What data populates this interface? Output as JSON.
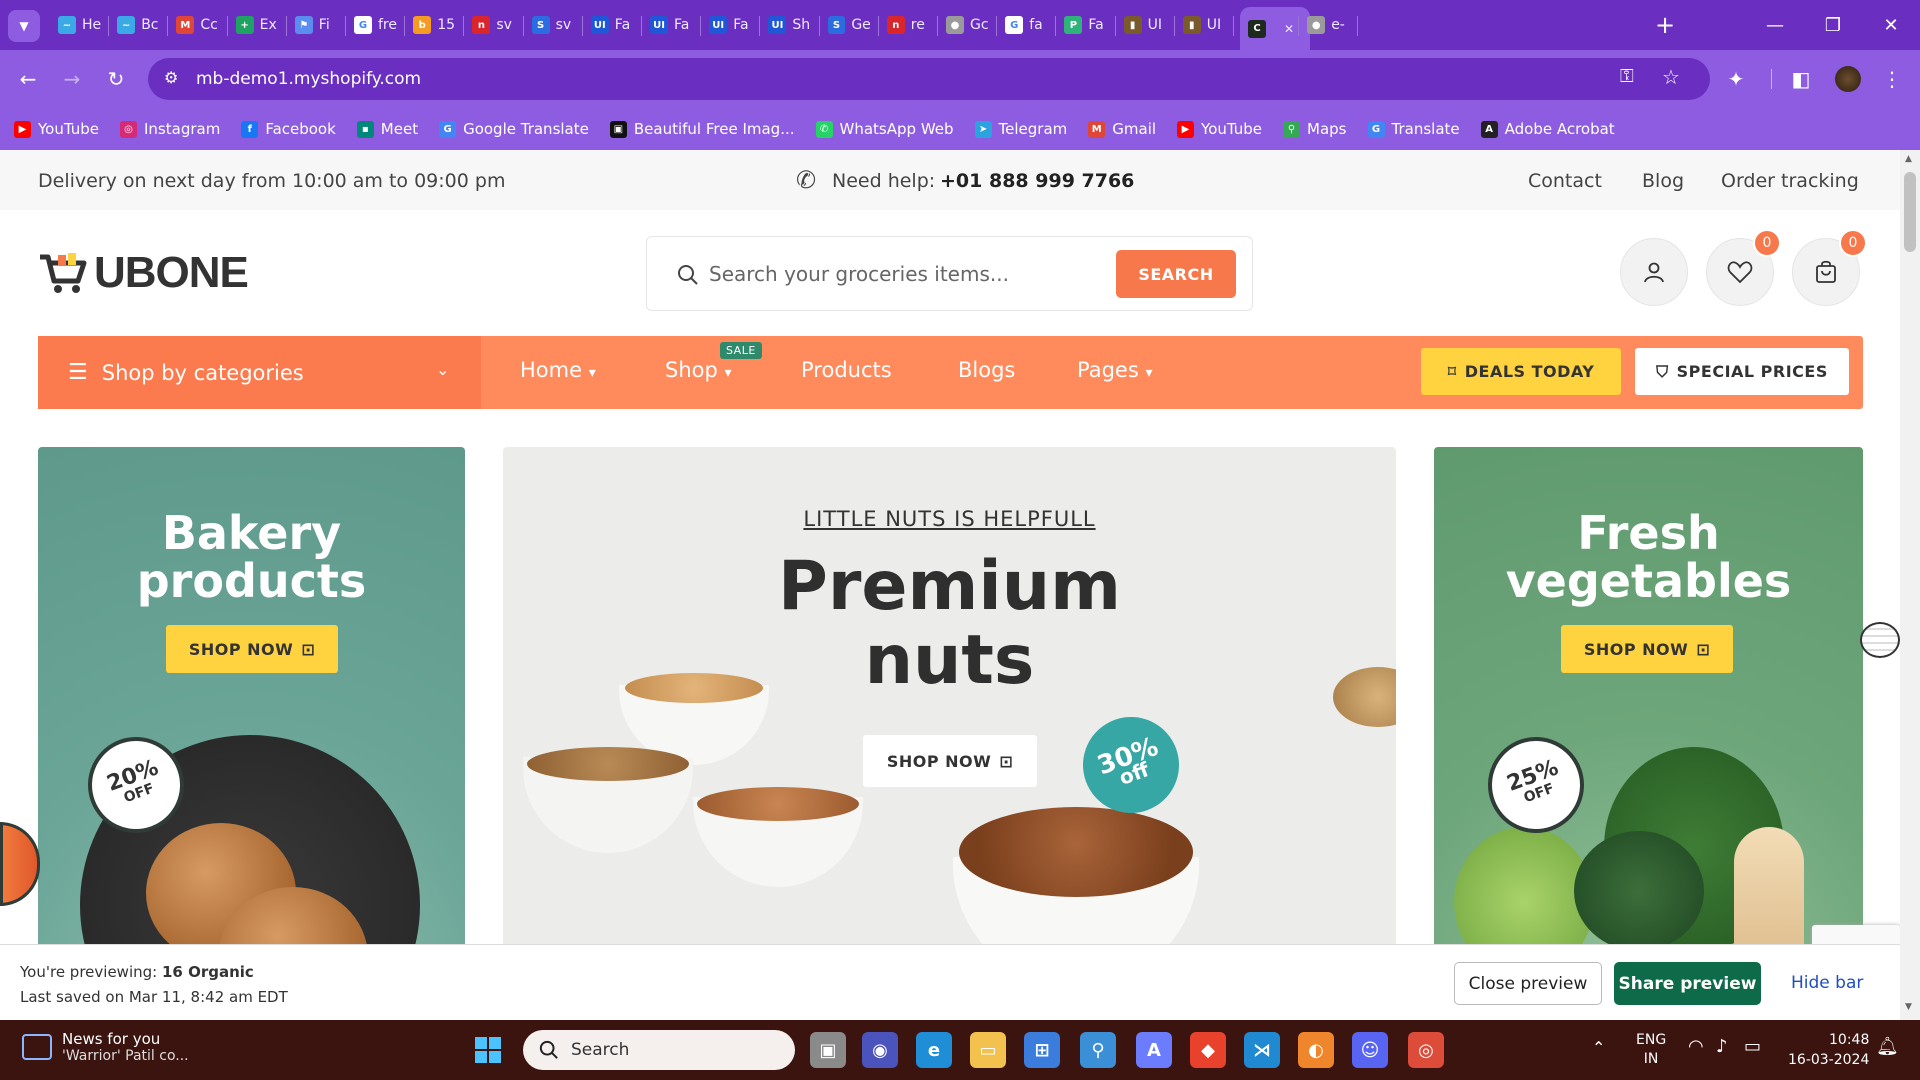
{
  "browser": {
    "tabs": [
      {
        "label": "He",
        "color": "#3aa9e6",
        "glyph": "~"
      },
      {
        "label": "Bc",
        "color": "#3aa9e6",
        "glyph": "~"
      },
      {
        "label": "Cc",
        "color": "#e04638",
        "glyph": "M"
      },
      {
        "label": "Ex",
        "color": "#1ea362",
        "glyph": "+"
      },
      {
        "label": "Fi",
        "color": "#5b8def",
        "glyph": "⚑"
      },
      {
        "label": "fre",
        "color": "#ffffff",
        "glyph": "G"
      },
      {
        "label": "15",
        "color": "#f59a23",
        "glyph": "b"
      },
      {
        "label": "sv",
        "color": "#d9262c",
        "glyph": "n"
      },
      {
        "label": "sv",
        "color": "#2b6de0",
        "glyph": "S"
      },
      {
        "label": "Fa",
        "color": "#1f57d6",
        "glyph": "UI"
      },
      {
        "label": "Fa",
        "color": "#1f57d6",
        "glyph": "UI"
      },
      {
        "label": "Fa",
        "color": "#1f57d6",
        "glyph": "UI"
      },
      {
        "label": "Sh",
        "color": "#1f57d6",
        "glyph": "UI"
      },
      {
        "label": "Ge",
        "color": "#2b6de0",
        "glyph": "S"
      },
      {
        "label": "re",
        "color": "#d9262c",
        "glyph": "n"
      },
      {
        "label": "Gc",
        "color": "#9a9a9a",
        "glyph": "●"
      },
      {
        "label": "fa",
        "color": "#ffffff",
        "glyph": "G"
      },
      {
        "label": "Fa",
        "color": "#2fb37a",
        "glyph": "P"
      },
      {
        "label": "UI",
        "color": "#7a5a2a",
        "glyph": "▮"
      },
      {
        "label": "UI",
        "color": "#7a5a2a",
        "glyph": "▮"
      },
      {
        "label": "",
        "color": "#1d2a1d",
        "glyph": "C",
        "active": true
      },
      {
        "label": "e-",
        "color": "#9a9a9a",
        "glyph": "●"
      }
    ],
    "new_tab": "+",
    "url": "mb-demo1.myshopify.com",
    "bookmarks": [
      {
        "label": "YouTube",
        "color": "#ff0000",
        "glyph": "▶"
      },
      {
        "label": "Instagram",
        "color": "#d62976",
        "glyph": "◎"
      },
      {
        "label": "Facebook",
        "color": "#1877f2",
        "glyph": "f"
      },
      {
        "label": "Meet",
        "color": "#00897b",
        "glyph": "▪"
      },
      {
        "label": "Google Translate",
        "color": "#4285f4",
        "glyph": "G"
      },
      {
        "label": "Beautiful Free Imag...",
        "color": "#111111",
        "glyph": "▣"
      },
      {
        "label": "WhatsApp Web",
        "color": "#25d366",
        "glyph": "✆"
      },
      {
        "label": "Telegram",
        "color": "#2aa3e0",
        "glyph": "➤"
      },
      {
        "label": "Gmail",
        "color": "#e04638",
        "glyph": "M"
      },
      {
        "label": "YouTube",
        "color": "#ff0000",
        "glyph": "▶"
      },
      {
        "label": "Maps",
        "color": "#34a853",
        "glyph": "⚲"
      },
      {
        "label": "Translate",
        "color": "#4285f4",
        "glyph": "G"
      },
      {
        "label": "Adobe Acrobat",
        "color": "#222222",
        "glyph": "A"
      }
    ]
  },
  "store": {
    "topbar": {
      "delivery": "Delivery on next day from 10:00 am to 09:00 pm",
      "help_label": "Need help:",
      "phone": "+01 888 999 7766",
      "links": [
        "Contact",
        "Blog",
        "Order tracking"
      ]
    },
    "logo": "UBONE",
    "search": {
      "placeholder": "Search your groceries items...",
      "button": "SEARCH"
    },
    "wishlist_count": "0",
    "cart_count": "0",
    "nav": {
      "categories": "Shop by categories",
      "items": [
        "Home",
        "Shop",
        "Products",
        "Blogs",
        "Pages"
      ],
      "sale_badge": "SALE",
      "deals": "DEALS TODAY",
      "special": "SPECIAL PRICES"
    },
    "banners": {
      "left": {
        "title_line1": "Bakery",
        "title_line2": "products",
        "button": "SHOP NOW",
        "discount": "20%",
        "off": "OFF"
      },
      "center": {
        "kicker": "LITTLE NUTS IS HELPFULL",
        "title_line1": "Premium",
        "title_line2": "nuts",
        "button": "SHOP NOW",
        "discount": "30%",
        "off": "off"
      },
      "right": {
        "title_line1": "Fresh",
        "title_line2": "vegetables",
        "button": "SHOP NOW",
        "discount": "25%",
        "off": "OFF"
      }
    }
  },
  "preview_bar": {
    "previewing_label": "You're previewing:",
    "theme": "16 Organic",
    "last_saved": "Last saved on Mar 11, 8:42 am EDT",
    "close": "Close preview",
    "share": "Share preview",
    "hide": "Hide bar"
  },
  "taskbar": {
    "news_title": "News for you",
    "news_sub": "'Warrior' Patil co...",
    "search": "Search",
    "lang1": "ENG",
    "lang2": "IN",
    "time": "10:48",
    "date": "16-03-2024"
  },
  "colors": {
    "brand_orange": "#ff8a5b",
    "yellow": "#ffd23f",
    "chrome_purple": "#8e5ce0",
    "share_green": "#0d6b4a"
  }
}
